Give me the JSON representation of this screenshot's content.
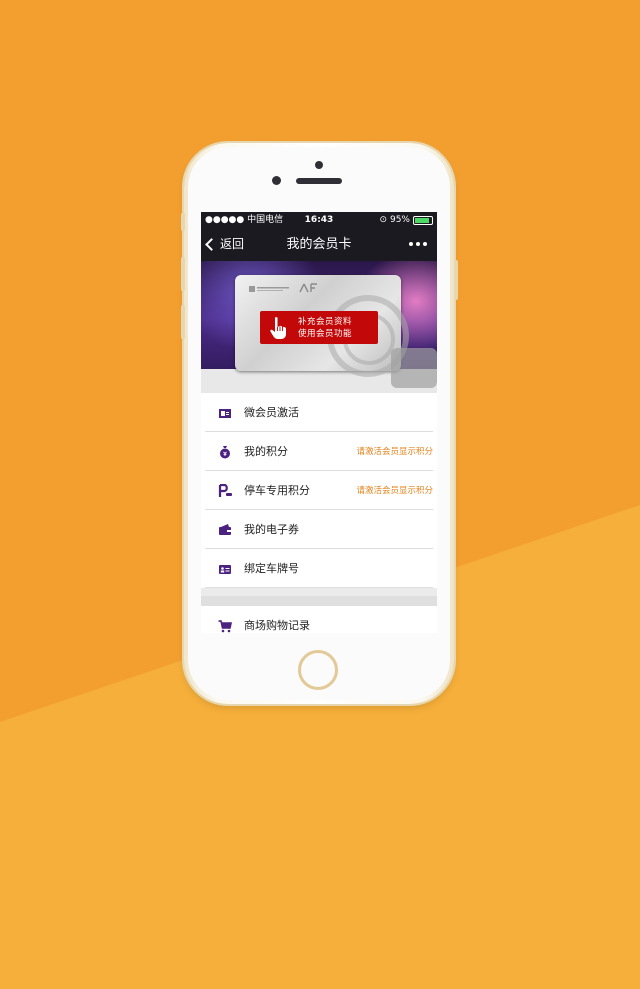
{
  "status_bar": {
    "carrier": "●●●●● 中国电信",
    "time": "16:43",
    "battery": "95%"
  },
  "nav": {
    "back_label": "返回",
    "title": "我的会员卡",
    "more_icon": "more-dots-icon"
  },
  "banner": {
    "card_cta_line1": "补充会员资料",
    "card_cta_line2": "使用会员功能",
    "card_cta_icon": "tap-hand-icon"
  },
  "menu": [
    {
      "label": "微会员激活",
      "icon": "id-card-icon",
      "hint": ""
    },
    {
      "label": "我的积分",
      "icon": "money-bag-icon",
      "hint": "请激活会员显示积分"
    },
    {
      "label": "停车专用积分",
      "icon": "parking-icon",
      "hint": "请激活会员显示积分"
    },
    {
      "label": "我的电子券",
      "icon": "wallet-icon",
      "hint": ""
    },
    {
      "label": "绑定车牌号",
      "icon": "license-plate-icon",
      "hint": ""
    }
  ],
  "menu2": [
    {
      "label": "商场购物记录",
      "icon": "shopping-cart-icon"
    }
  ],
  "colors": {
    "background": "#f39f30",
    "accent_icon": "#4b2282",
    "hint_text": "#e4821b",
    "cta_red": "#c20808"
  }
}
